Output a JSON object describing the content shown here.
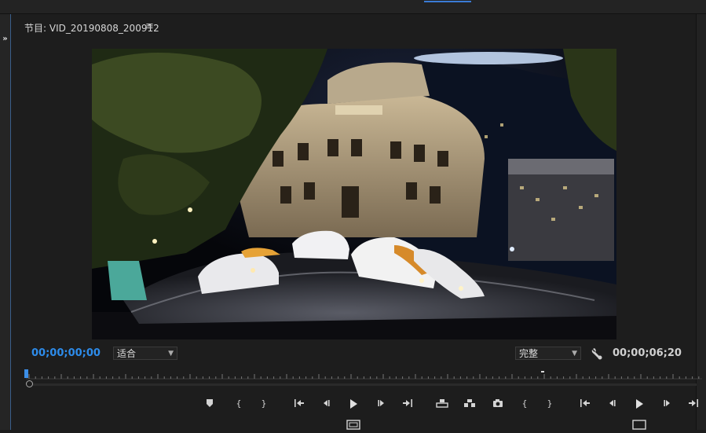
{
  "panel": {
    "title": "节目: VID_20190808_200912",
    "menu_icon": "≡",
    "expand_icon": "»"
  },
  "timecode": {
    "current": "00;00;00;00",
    "duration": "00;00;06;20"
  },
  "zoom_select": {
    "value": "适合"
  },
  "resolution_select": {
    "value": "完整"
  },
  "transport": {
    "left_labels": [
      "{",
      "}"
    ],
    "right_labels": [
      "{",
      "}"
    ]
  },
  "colors": {
    "accent": "#2d8ceb",
    "background": "#1d1d1d",
    "text": "#c8c8c8"
  },
  "icons": [
    "add-marker-icon",
    "mark-in-icon",
    "mark-out-icon",
    "go-to-in-icon",
    "step-back-icon",
    "play-icon",
    "step-forward-icon",
    "go-to-out-icon",
    "lift-icon",
    "extract-icon",
    "export-frame-icon",
    "settings-wrench-icon",
    "safe-margins-icon"
  ]
}
